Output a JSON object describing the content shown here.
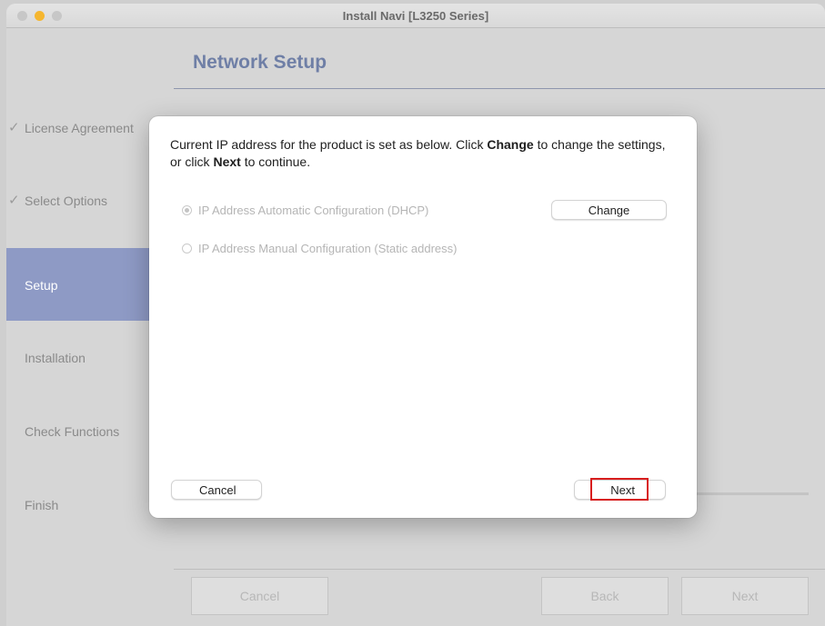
{
  "window": {
    "title": "Install Navi [L3250 Series]"
  },
  "page": {
    "heading": "Network Setup"
  },
  "sidebar": {
    "items": [
      {
        "label": "License Agreement",
        "done": true
      },
      {
        "label": "Select Options",
        "done": true
      },
      {
        "label": "Setup",
        "active": true
      },
      {
        "label": "Installation"
      },
      {
        "label": "Check Functions"
      },
      {
        "label": "Finish"
      }
    ],
    "check_glyph": "✓"
  },
  "footer": {
    "cancel_label": "Cancel",
    "back_label": "Back",
    "next_label": "Next"
  },
  "dialog": {
    "message_part1": "Current IP address for the product is set as below. Click ",
    "message_change": "Change",
    "message_part2": " to change the settings, or click ",
    "message_next": "Next",
    "message_part3": " to continue.",
    "options": [
      {
        "label": "IP Address Automatic Configuration (DHCP)",
        "selected": true
      },
      {
        "label": "IP Address Manual Configuration (Static address)",
        "selected": false
      }
    ],
    "change_label": "Change",
    "cancel_label": "Cancel",
    "next_label": "Next"
  },
  "colors": {
    "accent": "#8e9ac5",
    "heading": "#6f7fa6",
    "highlight": "#d81e1e"
  }
}
